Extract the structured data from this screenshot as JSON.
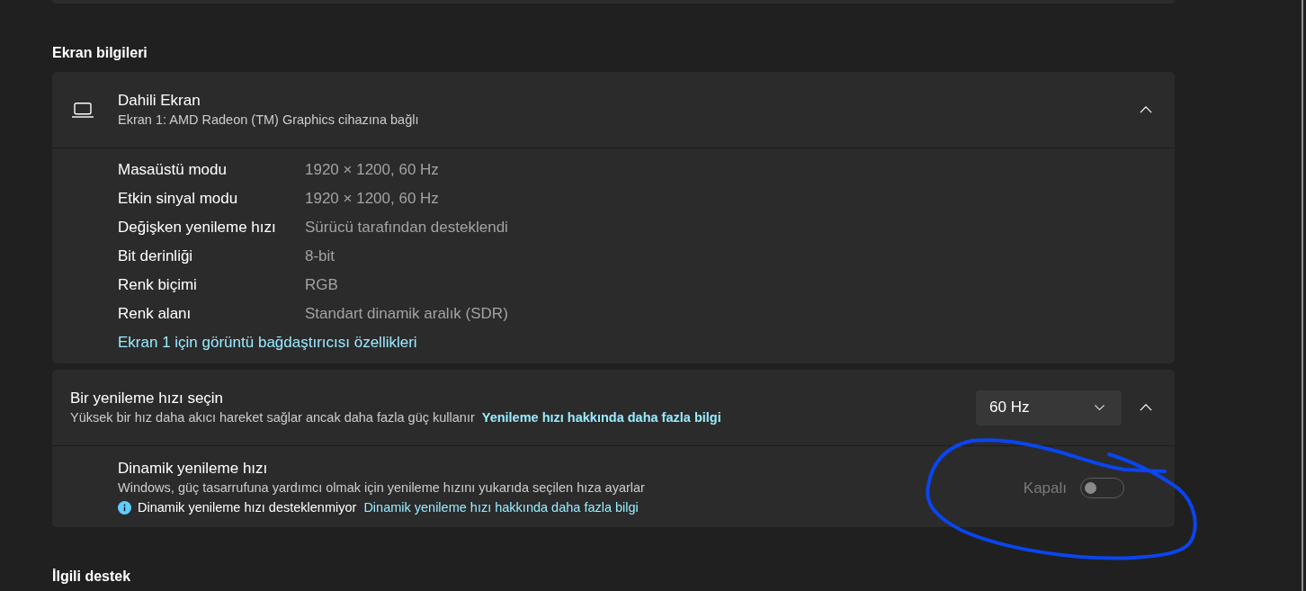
{
  "display_info": {
    "heading": "Ekran bilgileri",
    "card": {
      "title": "Dahili Ekran",
      "subtitle": "Ekran 1: AMD Radeon (TM) Graphics cihazına bağlı",
      "expanded": true,
      "rows": [
        {
          "label": "Masaüstü modu",
          "value": "1920 × 1200, 60 Hz"
        },
        {
          "label": "Etkin sinyal modu",
          "value": "1920 × 1200, 60 Hz"
        },
        {
          "label": "Değişken yenileme hızı",
          "value": "Sürücü tarafından desteklendi"
        },
        {
          "label": "Bit derinliği",
          "value": "8-bit"
        },
        {
          "label": "Renk biçimi",
          "value": "RGB"
        },
        {
          "label": "Renk alanı",
          "value": "Standart dinamik aralık (SDR)"
        }
      ],
      "link": "Ekran 1 için görüntü bağdaştırıcısı özellikleri"
    }
  },
  "refresh_rate": {
    "title": "Bir yenileme hızı seçin",
    "description": "Yüksek bir hız daha akıcı hareket sağlar ancak daha fazla güç kullanır",
    "link": "Yenileme hızı hakkında daha fazla bilgi",
    "dropdown": {
      "value": "60 Hz"
    },
    "expanded": true,
    "dynamic": {
      "title": "Dinamik yenileme hızı",
      "description": "Windows, güç tasarrufuna yardımcı olmak için yenileme hızını yukarıda seçilen hıza ayarlar",
      "notice": "Dinamik yenileme hızı desteklenmiyor",
      "link": "Dinamik yenileme hızı hakkında daha fazla bilgi",
      "toggle": {
        "label": "Kapalı",
        "on": false,
        "disabled": true
      }
    }
  },
  "related": {
    "heading": "İlgili destek"
  }
}
